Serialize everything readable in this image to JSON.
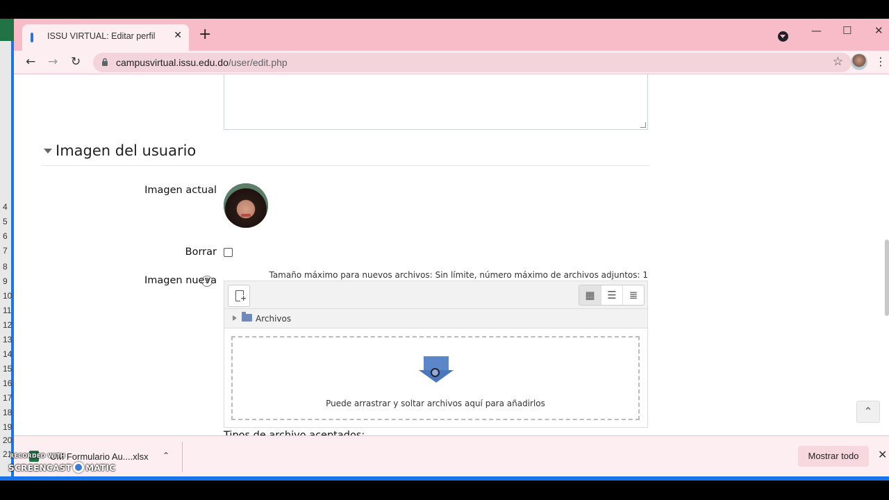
{
  "browser": {
    "tab_title": "ISSU VIRTUAL: Editar perfil",
    "tab_close": "✕",
    "new_tab": "+",
    "url_host": "campusvirtual.issu.edu.do",
    "url_path": "/user/edit.php",
    "controls": {
      "minimize": "—",
      "maximize": "☐",
      "close": "✕"
    },
    "nav": {
      "back": "←",
      "forward": "→",
      "reload": "↻"
    },
    "star": "☆",
    "menu": "⋮"
  },
  "excel_rows": [
    "4",
    "5",
    "6",
    "7",
    "8",
    "9",
    "10",
    "11",
    "12",
    "13",
    "14",
    "15",
    "16",
    "17",
    "18",
    "19",
    "20",
    "21"
  ],
  "section": {
    "title": "Imagen del usuario"
  },
  "form": {
    "current_image_label": "Imagen actual",
    "delete_label": "Borrar",
    "new_image_label": "Imagen nueva",
    "help_icon": "?",
    "max_info": "Tamaño máximo para nuevos archivos: Sin límite, número máximo de archivos adjuntos: 1",
    "folder_name": "Archivos",
    "drop_text": "Puede arrastrar y soltar archivos aquí para añadirlos",
    "accepted_types_label": "Tipos de archivo aceptados:"
  },
  "filepicker_views": [
    "▦",
    "☰",
    "≣"
  ],
  "back_to_top": "⌃",
  "downloads": {
    "file_name": "UM Formulario Au....xlsx",
    "chevron": "⌃",
    "show_all": "Mostrar todo",
    "close": "✕"
  },
  "watermark": {
    "line1": "RECORDED WITH",
    "line2a": "SCREENCAST",
    "line2b": "MATIC"
  },
  "colors": {
    "tabbar": "#f8bbc8",
    "accent_blue": "#1a73e8",
    "excel_green": "#217346"
  }
}
